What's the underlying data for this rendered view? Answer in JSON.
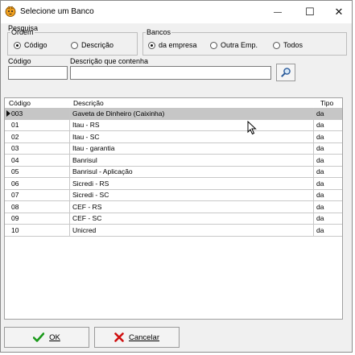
{
  "window": {
    "title": "Selecione um Banco",
    "minimize_glyph": "—",
    "maximize_glyph": "☐",
    "close_glyph": "✕",
    "icon": "app-tiger-icon"
  },
  "filter": {
    "group_label": "Pesquisa",
    "ordem": {
      "label": "Ordem",
      "options": [
        {
          "label": "Código",
          "checked": true
        },
        {
          "label": "Descrição",
          "checked": false
        }
      ]
    },
    "bancos": {
      "label": "Bancos",
      "options": [
        {
          "label": "da empresa",
          "checked": true
        },
        {
          "label": "Outra Emp.",
          "checked": false
        },
        {
          "label": "Todos",
          "checked": false
        }
      ]
    },
    "codigo_label": "Código",
    "codigo_value": "",
    "descricao_label": "Descrição que contenha",
    "descricao_value": "",
    "search_icon": "magnifier-icon"
  },
  "grid": {
    "columns": [
      "Código",
      "Descrição",
      "Tipo"
    ],
    "selected_index": 0,
    "rows": [
      {
        "codigo": "003",
        "descricao": "Gaveta de Dinheiro (Caixinha)",
        "tipo": "da"
      },
      {
        "codigo": "01",
        "descricao": "Itau - RS",
        "tipo": "da"
      },
      {
        "codigo": "02",
        "descricao": "Itau - SC",
        "tipo": "da"
      },
      {
        "codigo": "03",
        "descricao": "Itau - garantia",
        "tipo": "da"
      },
      {
        "codigo": "04",
        "descricao": "Banrisul",
        "tipo": "da"
      },
      {
        "codigo": "05",
        "descricao": "Banrisul - Aplicação",
        "tipo": "da"
      },
      {
        "codigo": "06",
        "descricao": "Sicredi - RS",
        "tipo": "da"
      },
      {
        "codigo": "07",
        "descricao": "Sicredi - SC",
        "tipo": "da"
      },
      {
        "codigo": "08",
        "descricao": "CEF - RS",
        "tipo": "da"
      },
      {
        "codigo": "09",
        "descricao": "CEF - SC",
        "tipo": "da"
      },
      {
        "codigo": "10",
        "descricao": "Unicred",
        "tipo": "da"
      }
    ]
  },
  "buttons": {
    "ok_label": "OK",
    "ok_icon": "checkmark-icon",
    "ok_color": "#1a9a1a",
    "cancel_label": "Cancelar",
    "cancel_icon": "red-x-icon",
    "cancel_color": "#d01010"
  }
}
